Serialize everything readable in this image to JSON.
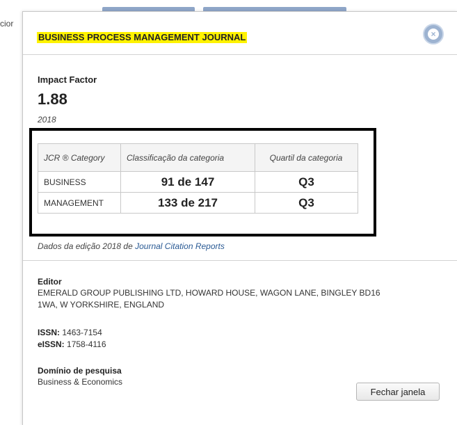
{
  "background": {
    "cut_text": "cior"
  },
  "modal": {
    "journal_title": "BUSINESS PROCESS MANAGEMENT JOURNAL",
    "close_icon": "close-circle-icon",
    "close_glyph": "×",
    "impact_factor": {
      "label": "Impact Factor",
      "value": "1.88",
      "year": "2018"
    },
    "jcr_table": {
      "headers": [
        "JCR ® Category",
        "Classificação da categoria",
        "Quartil da categoria"
      ],
      "rows": [
        {
          "category": "BUSINESS",
          "rank": "91 de 147",
          "quartile": "Q3"
        },
        {
          "category": "MANAGEMENT",
          "rank": "133 de 217",
          "quartile": "Q3"
        }
      ]
    },
    "edition_note": {
      "prefix": "Dados da edição 2018 de ",
      "link": "Journal Citation Reports"
    },
    "editor": {
      "label": "Editor",
      "line1": "EMERALD GROUP PUBLISHING LTD, HOWARD HOUSE, WAGON LANE, BINGLEY BD16",
      "line2": "1WA, W YORKSHIRE, ENGLAND"
    },
    "issn": {
      "label": "ISSN:",
      "value": "1463-7154"
    },
    "eissn": {
      "label": "eISSN:",
      "value": "1758-4116"
    },
    "research_domain": {
      "label": "Domínio de pesquisa",
      "value": "Business & Economics"
    },
    "close_window_label": "Fechar janela",
    "colors": {
      "title_highlight": "#fff200",
      "close_button": "#9db3d1",
      "link": "#2a5a94",
      "highlight_box_border": "#000000"
    }
  }
}
